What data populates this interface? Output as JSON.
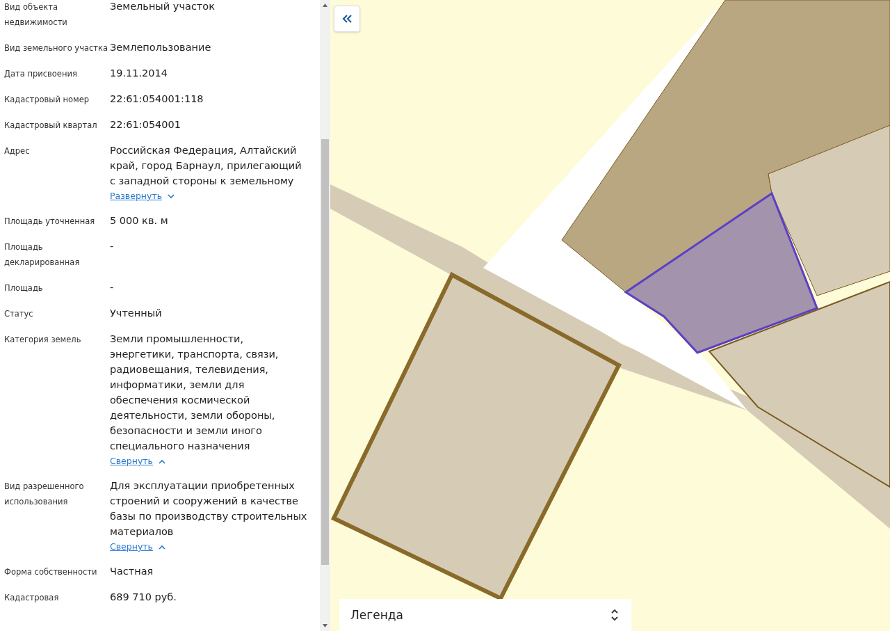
{
  "properties": [
    {
      "label": "Вид объекта недвижимости",
      "value": "Земельный участок"
    },
    {
      "label": "Вид земельного участка",
      "value": "Землепользование"
    },
    {
      "label": "Дата присвоения",
      "value": "19.11.2014"
    },
    {
      "label": "Кадастровый номер",
      "value": "22:61:054001:118"
    },
    {
      "label": "Кадастровый квартал",
      "value": "22:61:054001"
    },
    {
      "label": "Адрес",
      "value": "Российская Федерация, Алтайский край, город Барнаул, прилегающий с западной стороны к земельному",
      "toggle": {
        "text": "Развернуть",
        "expanded": false
      }
    },
    {
      "label": "Площадь уточненная",
      "value": "5 000 кв. м"
    },
    {
      "label": "Площадь декларированная",
      "value": "-"
    },
    {
      "label": "Площадь",
      "value": "-"
    },
    {
      "label": "Статус",
      "value": "Учтенный"
    },
    {
      "label": "Категория земель",
      "value": "Земли промышленности, энергетики, транспорта, связи, радиовещания, телевидения, информатики, земли для обеспечения космической деятельности, земли обороны, безопасности и земли иного специального назначения",
      "toggle": {
        "text": "Свернуть",
        "expanded": true
      }
    },
    {
      "label": "Вид разрешенного использования",
      "value": "Для эксплуатации приобретенных строений и сооружений в качестве базы по производству строительных материалов",
      "toggle": {
        "text": "Свернуть",
        "expanded": true
      }
    },
    {
      "label": "Форма собственности",
      "value": "Частная"
    },
    {
      "label": "Кадастровая",
      "value": "689 710 руб."
    }
  ],
  "legend": {
    "label": "Легенда"
  }
}
